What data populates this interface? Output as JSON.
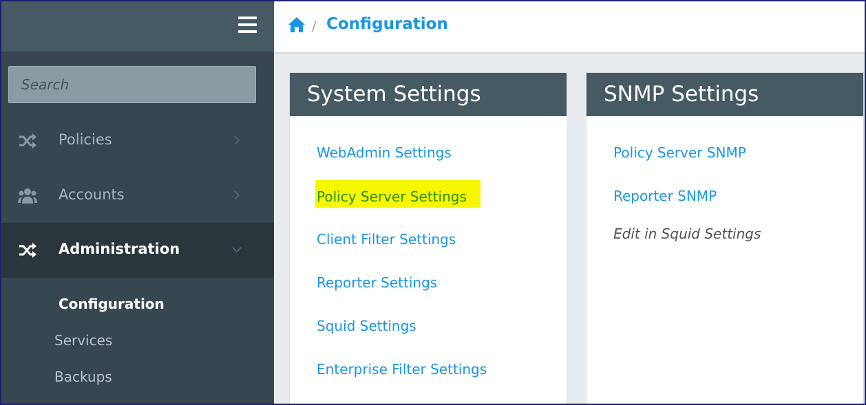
{
  "sidebar": {
    "menu_icon": "hamburger-icon",
    "search": {
      "placeholder": "Search",
      "value": ""
    },
    "items": [
      {
        "label": "Policies",
        "icon": "shuffle-icon",
        "expanded": false
      },
      {
        "label": "Accounts",
        "icon": "users-icon",
        "expanded": false
      },
      {
        "label": "Administration",
        "icon": "shuffle-icon",
        "expanded": true
      }
    ],
    "subitems": [
      {
        "label": "Configuration",
        "current": true
      },
      {
        "label": "Services",
        "current": false
      },
      {
        "label": "Backups",
        "current": false
      }
    ]
  },
  "header": {
    "home_icon": "home-icon",
    "separator": "/",
    "breadcrumb_current": "Configuration"
  },
  "panels": [
    {
      "title": "System Settings",
      "links": [
        "WebAdmin Settings",
        "Policy Server Settings",
        "Client Filter Settings",
        "Reporter Settings",
        "Squid Settings",
        "Enterprise Filter Settings"
      ]
    },
    {
      "title": "SNMP Settings",
      "links": [
        "Policy Server SNMP",
        "Reporter SNMP"
      ],
      "note": "Edit in Squid Settings"
    }
  ],
  "colors": {
    "sidebar_bg": "#37474f",
    "sidebar_header": "#465a64",
    "active_item": "#2a363c",
    "link": "#1796e8",
    "highlight": "#f6f700",
    "highlight_text": "#2e8f0a",
    "frame_border": "#1c1f73"
  }
}
